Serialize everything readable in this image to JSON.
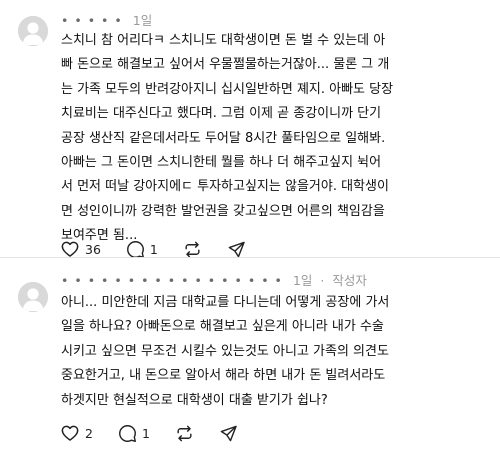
{
  "posts": [
    {
      "username": "• • • • •",
      "time": "1일",
      "author_badge": "",
      "text": "스치니 참 어리다ㅋ 스치니도 대학생이면 돈 벌 수 있는데 아\n빠 돈으로 해결보고 싶어서 우물쩔물하는거잖아... 물론 그 개\n는 가족 모두의 반려강아지니 십시일반하면 졔지. 아빠도 당장\n치료비는 대주신다고 했다며. 그럼 이제 곧 종강이니까 단기\n공장 생산직 같은데서라도 두어달 8시간 풀타임으로 일해봐.\n아빠는 그 돈이면 스치니한테 뭘를 하나 더 해주고싶지 뉙어\n서 먼저 떠날 강아지에ㄷ 투자하고싶지는 않을거야. 대학생이\n면 성인이니까 강력한 발언권을 갖고싶으면 어른의 책임감을\n보여주면 됨...",
      "likes": "36",
      "comments": "1"
    },
    {
      "username": "• • • • • • • • • • • • • • • • •",
      "time": "1일",
      "author_badge": "작성자",
      "text": "아니... 미안한데 지금 대학교를 다니는데 어떻게 공장에 가서\n일을 하나요? 아빠돈으로 해결보고 싶은게 아니라 내가 수술\n시키고 싶으면 무조건 시킬수 있는것도 아니고 가족의 의견도\n중요한거고, 내 돈으로 알아서 해라 하면 내가 돈 빌려서라도\n하겟지만 현실적으로 대학생이 대출 받기가 쉽나?",
      "likes": "2",
      "comments": "1"
    }
  ],
  "icons": {
    "like": "heart-icon",
    "comment": "comment-bubble-icon",
    "repost": "repost-icon",
    "share": "send-icon"
  },
  "colors": {
    "text": "#0f0f0f",
    "muted": "#9a9a9a",
    "avatar_bg": "#d9d9d9",
    "avatar_fg": "#ffffff"
  }
}
